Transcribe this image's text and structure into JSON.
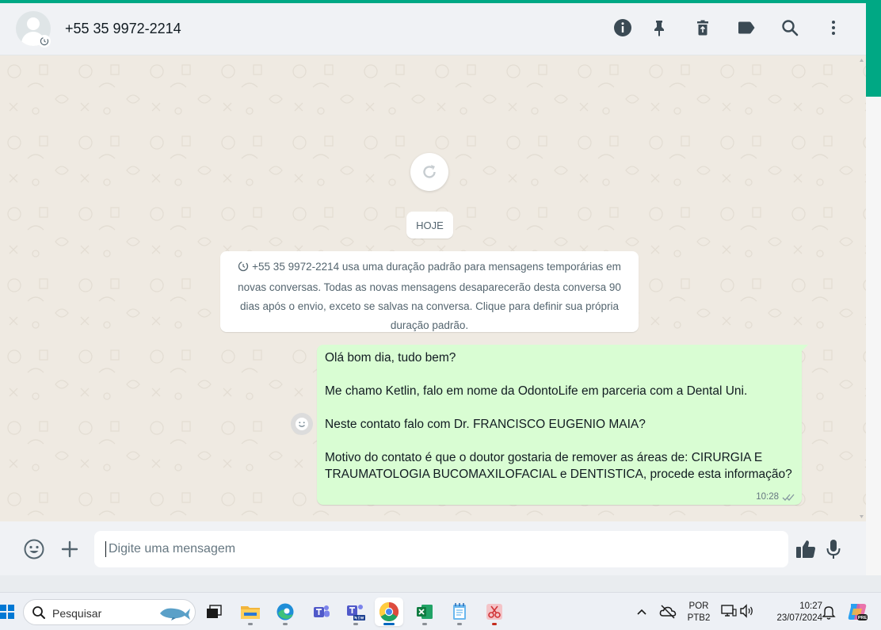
{
  "header": {
    "contact": "+55 35 9972-2214",
    "icons": [
      "info-icon",
      "pin-icon",
      "delete-icon",
      "label-icon",
      "search-icon",
      "more-icon"
    ]
  },
  "conversation": {
    "date_chip": "HOJE",
    "system_message": "+55 35 9972-2214 usa uma duração padrão para mensagens temporárias em novas conversas. Todas as novas mensagens desaparecerão desta conversa 90 dias após o envio, exceto se salvas na conversa. Clique para definir sua própria duração padrão.",
    "message": {
      "lines": [
        "Olá bom dia, tudo bem?",
        "Me chamo Ketlin, falo em nome da OdontoLife em parceria com a Dental Uni.",
        "Neste contato falo com Dr. FRANCISCO EUGENIO MAIA?",
        "Motivo do contato é que o doutor gostaria de remover as áreas de: CIRURGIA E TRAUMATOLOGIA BUCOMAXILOFACIAL e DENTISTICA, procede esta informação?"
      ],
      "time": "10:28",
      "status": "read"
    }
  },
  "composer": {
    "placeholder": "Digite uma mensagem"
  },
  "taskbar": {
    "search_placeholder": "Pesquisar",
    "lang_line1": "POR",
    "lang_line2": "PTB2",
    "time": "10:27",
    "date": "23/07/2024"
  },
  "colors": {
    "accent": "#00a884",
    "outgoing_bubble": "#d9fdd3",
    "chat_background": "#efeae2"
  }
}
